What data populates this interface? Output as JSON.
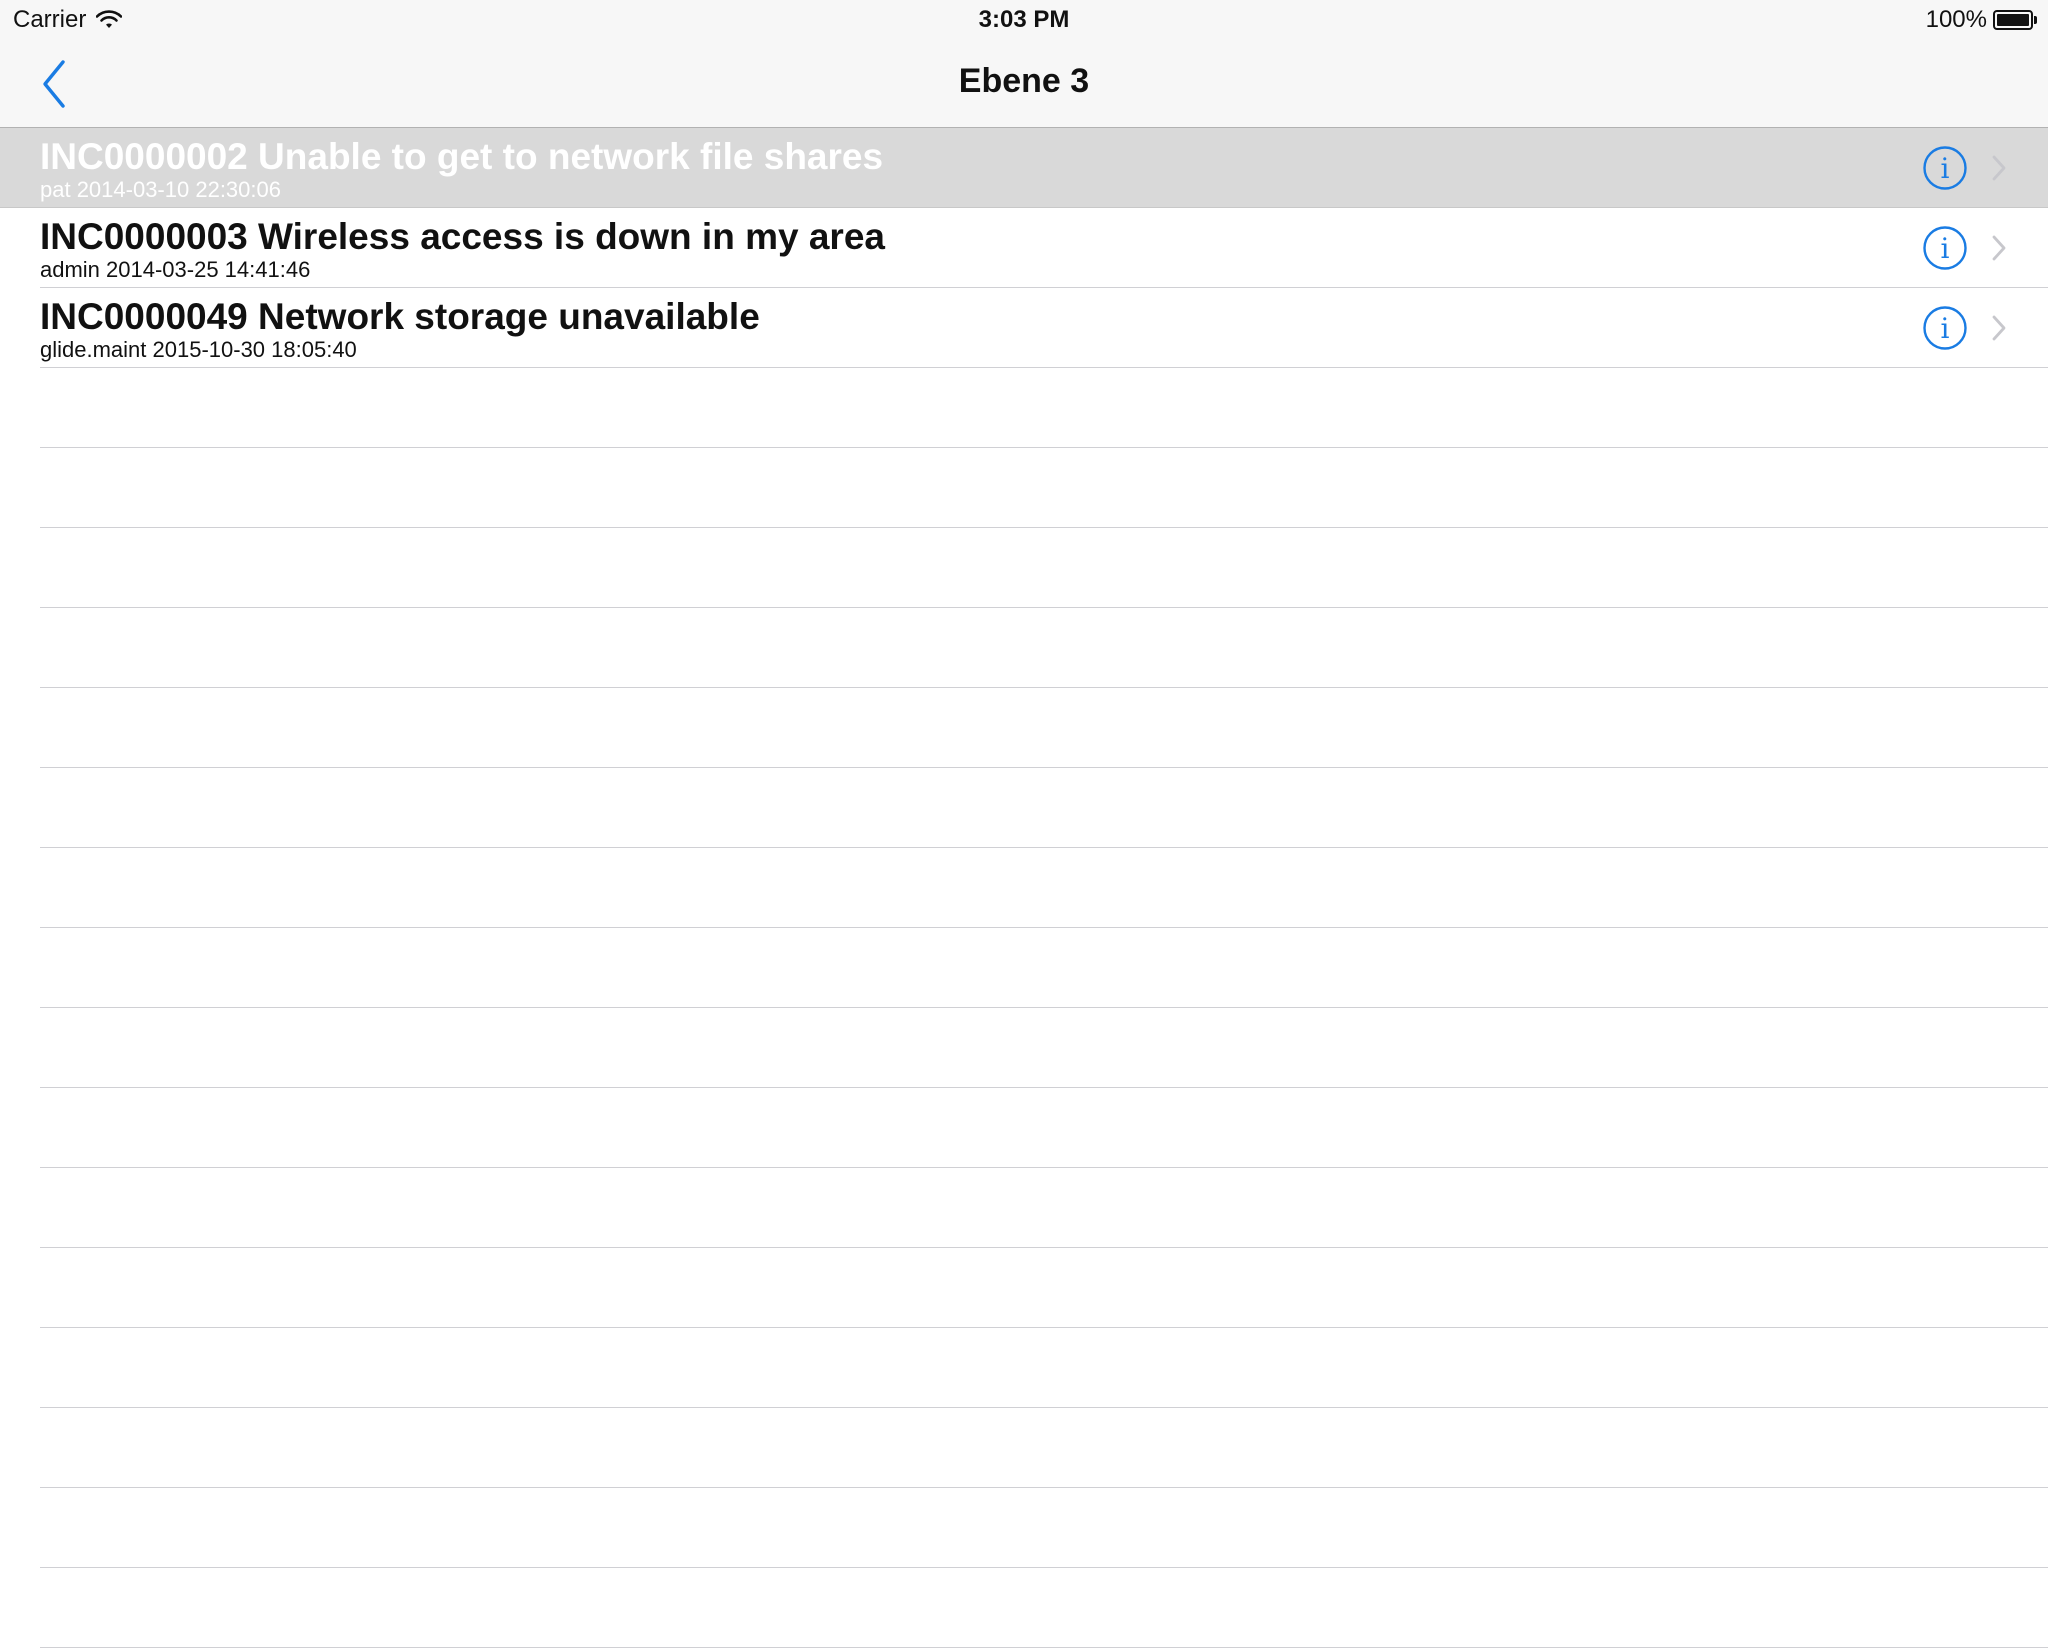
{
  "status_bar": {
    "carrier": "Carrier",
    "time": "3:03 PM",
    "battery": "100%",
    "battery_level": 1.0,
    "wifi_icon": "wifi-icon",
    "battery_icon": "battery-icon"
  },
  "nav": {
    "title": "Ebene 3",
    "back_icon": "chevron-left-icon",
    "accent": "#1a7ce3"
  },
  "rows": [
    {
      "title": "INC0000002 Unable to get to network file shares",
      "subtitle": "pat 2014-03-10 22:30:06",
      "selected": true
    },
    {
      "title": "INC0000003 Wireless access is down in my area",
      "subtitle": "admin 2014-03-25 14:41:46",
      "selected": false
    },
    {
      "title": "INC0000049 Network storage unavailable",
      "subtitle": "glide.maint 2015-10-30 18:05:40",
      "selected": false
    }
  ],
  "row_icons": {
    "info": "info-icon",
    "disclosure": "chevron-right-icon"
  },
  "colors": {
    "selected_row": "#d9d9d9",
    "separator": "#d0d0d4",
    "chevron": "#c7c7cc"
  }
}
